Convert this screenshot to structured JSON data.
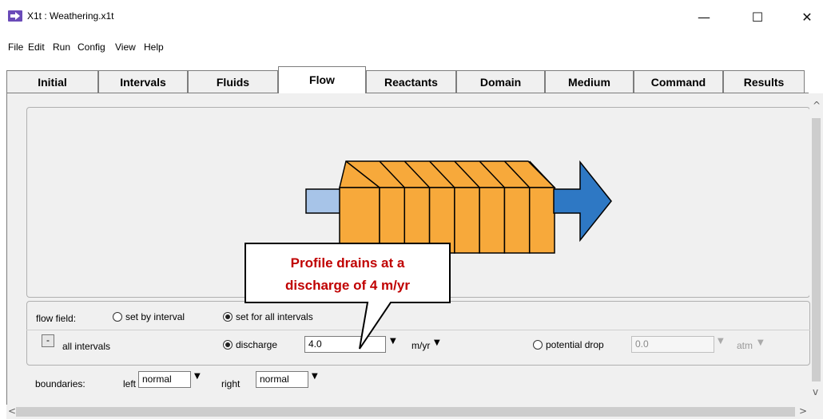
{
  "window": {
    "title": "X1t : Weathering.x1t",
    "minimize_glyph": "—",
    "maximize_glyph": "☐",
    "close_glyph": "✕",
    "icon": "arrow-right-icon"
  },
  "menu": [
    "File",
    "Edit",
    "Run",
    "Config",
    "View",
    "Help"
  ],
  "tabs": [
    "Initial",
    "Intervals",
    "Fluids",
    "Flow",
    "Reactants",
    "Domain",
    "Medium",
    "Command",
    "Results"
  ],
  "active_tab": "Flow",
  "diagram": {
    "colors": {
      "inlet": "#a7c4e8",
      "column": "#f7a93b",
      "outlet": "#2e78c4"
    },
    "cell_count": 8
  },
  "callout": {
    "line1": "Profile drains at a",
    "line2": "discharge of 4 m/yr",
    "color": "#c00000"
  },
  "flow_field": {
    "label": "flow field:",
    "option_interval": "set by interval",
    "option_all": "set for all intervals",
    "selected": "set for all intervals"
  },
  "all_intervals": {
    "collapse_label": "-",
    "label": "all intervals",
    "discharge_label": "discharge",
    "discharge_value": "4.0",
    "discharge_unit": "m/yr",
    "potential_label": "potential drop",
    "potential_value": "0.0",
    "potential_unit": "atm"
  },
  "boundaries": {
    "label": "boundaries:",
    "left_label": "left",
    "left_value": "normal",
    "right_label": "right",
    "right_value": "normal"
  },
  "scroll": {
    "up": "^",
    "down": "v",
    "left": "<",
    "right": ">"
  }
}
